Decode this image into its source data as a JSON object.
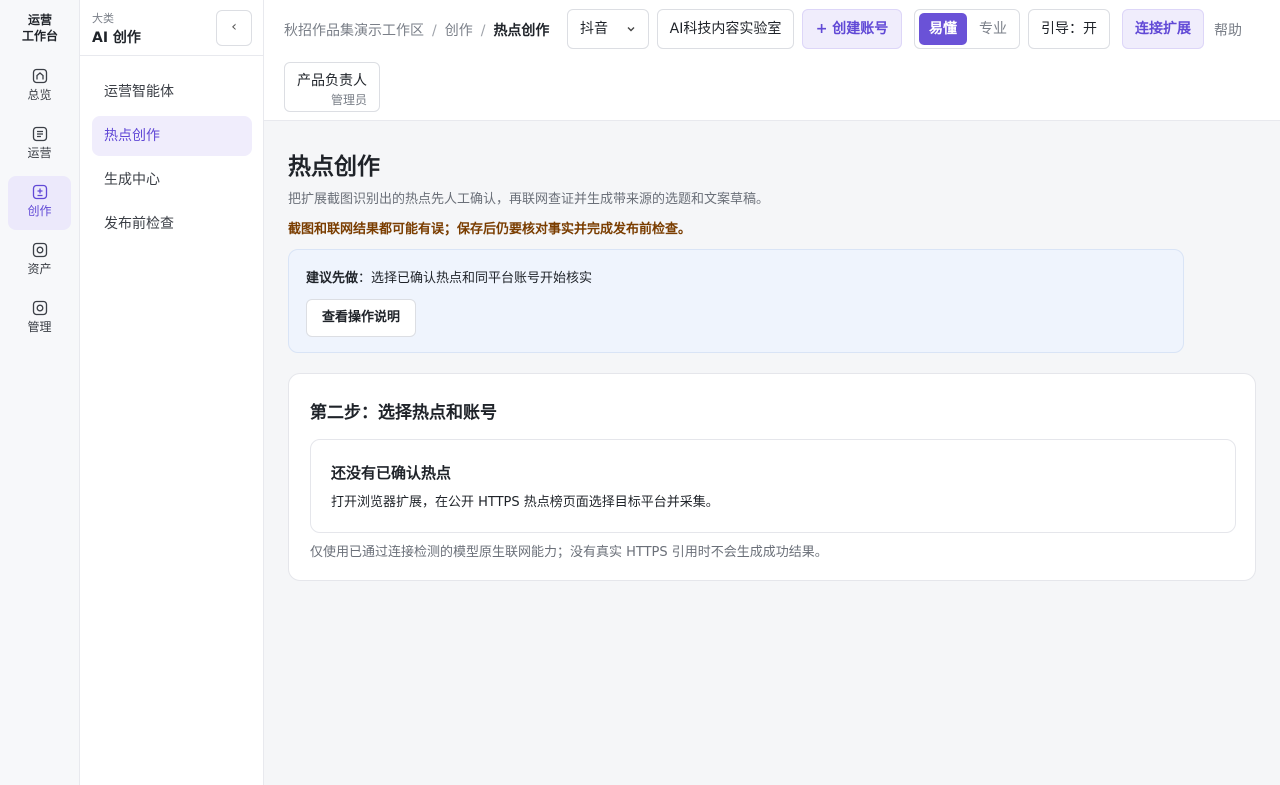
{
  "rail": {
    "brand_line1": "运营",
    "brand_line2": "工作台",
    "items": [
      {
        "label": "总览",
        "icon": "home-icon"
      },
      {
        "label": "运营",
        "icon": "list-icon"
      },
      {
        "label": "创作",
        "icon": "create-icon",
        "active": true
      },
      {
        "label": "资产",
        "icon": "asset-icon"
      },
      {
        "label": "管理",
        "icon": "admin-icon"
      }
    ]
  },
  "sidebar": {
    "category": "大类",
    "title": "AI 创作",
    "collapse": "‹",
    "items": [
      {
        "label": "运营智能体"
      },
      {
        "label": "热点创作",
        "active": true
      },
      {
        "label": "生成中心"
      },
      {
        "label": "发布前检查"
      }
    ]
  },
  "header": {
    "breadcrumb": [
      "秋招作品集演示工作区",
      "创作",
      "热点创作"
    ],
    "breadcrumb_sep": "/",
    "platform_select": "抖音",
    "account": "AI科技内容实验室",
    "create_account": "+ 创建账号",
    "mode_on": "易懂",
    "mode_off": "专业",
    "guide": "引导：开",
    "connect": "连接扩展",
    "help": "帮助",
    "user_role": "产品负责人",
    "user_sub": "管理员"
  },
  "main": {
    "title": "热点创作",
    "description": "把扩展截图识别出的热点先人工确认，再联网查证并生成带来源的选题和文案草稿。",
    "warning": "截图和联网结果都可能有误；保存后仍要核对事实并完成发布前检查。",
    "tip_label": "建议先做",
    "tip_text": "：选择已确认热点和同平台账号开始核实",
    "tip_button": "查看操作说明",
    "step_title": "第二步：选择热点和账号",
    "empty_title": "还没有已确认热点",
    "empty_desc": "打开浏览器扩展，在公开 HTTPS 热点榜页面选择目标平台并采集。",
    "note": "仅使用已通过连接检测的模型原生联网能力；没有真实 HTTPS 引用时不会生成成功结果。"
  },
  "colors": {
    "accent": "#6a52d7",
    "accent_soft": "#f0edfc",
    "warning_text": "#7a3d00",
    "tip_bg": "#eff4fd"
  }
}
